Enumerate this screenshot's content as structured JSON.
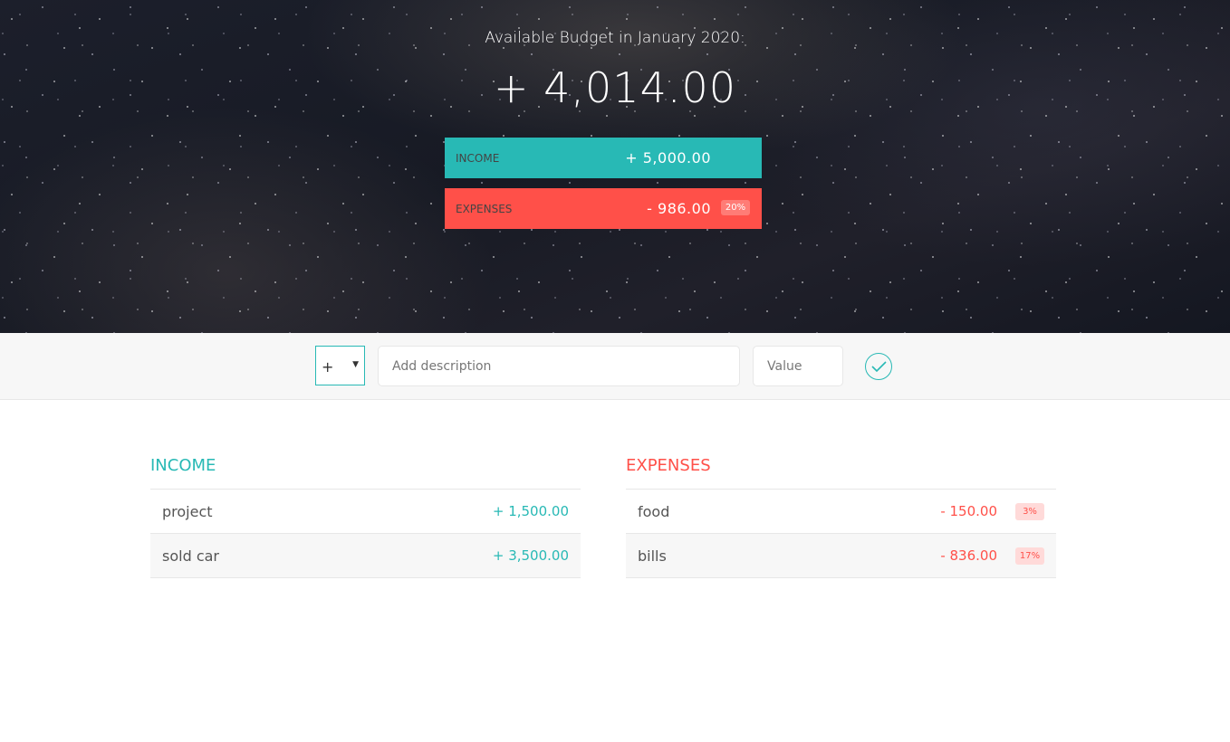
{
  "header": {
    "title": "Available Budget in January 2020:",
    "budget": "+ 4,014.00"
  },
  "summary": {
    "income_label": "Income",
    "income_value": "+ 5,000.00",
    "expenses_label": "Expenses",
    "expenses_value": "- 986.00",
    "expenses_percentage": "20%"
  },
  "add_form": {
    "type_selected": "+",
    "description_placeholder": "Add description",
    "value_placeholder": "Value"
  },
  "income": {
    "title": "Income",
    "items": [
      {
        "description": "project",
        "value": "+ 1,500.00"
      },
      {
        "description": "sold car",
        "value": "+ 3,500.00"
      }
    ]
  },
  "expenses": {
    "title": "Expenses",
    "items": [
      {
        "description": "food",
        "value": "- 150.00",
        "percentage": "3%"
      },
      {
        "description": "bills",
        "value": "- 836.00",
        "percentage": "17%"
      }
    ]
  },
  "colors": {
    "income": "#28b9b5",
    "expenses": "#ff5049"
  }
}
